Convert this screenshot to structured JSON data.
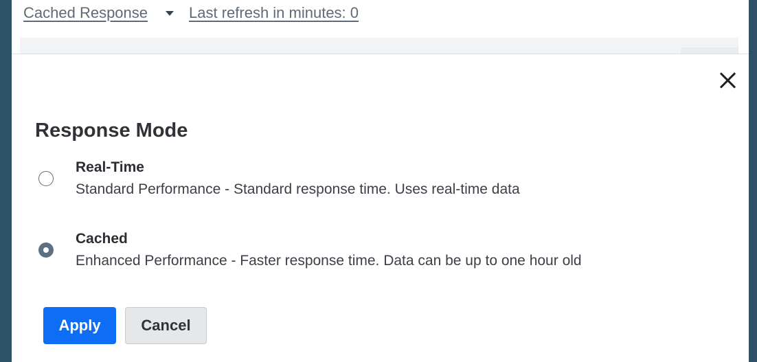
{
  "header": {
    "response_mode_link": "Cached Response",
    "refresh_link": "Last refresh in minutes: 0"
  },
  "dialog": {
    "title": "Response Mode",
    "options": [
      {
        "label": "Real-Time",
        "description": "Standard Performance - Standard response time. Uses real-time data",
        "selected": false
      },
      {
        "label": "Cached",
        "description": "Enhanced Performance - Faster response time. Data can be up to one hour old",
        "selected": true
      }
    ],
    "apply_label": "Apply",
    "cancel_label": "Cancel",
    "close_icon": "close-icon"
  },
  "colors": {
    "backdrop": "#2d5166",
    "primary": "#0d6ef5",
    "radio_selected": "#5f6f86"
  }
}
